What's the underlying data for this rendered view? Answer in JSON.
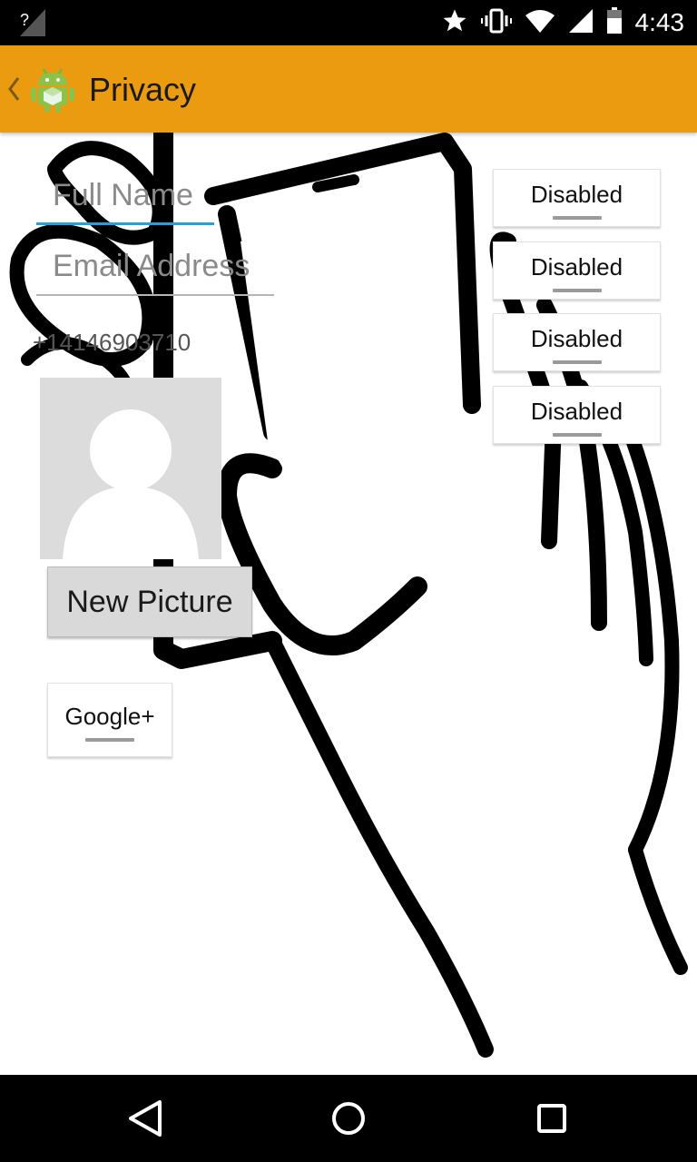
{
  "status_bar": {
    "time": "4:43",
    "signal_text": "?",
    "icons": [
      "signal-unknown-icon",
      "star-icon",
      "vibrate-icon",
      "wifi-icon",
      "cell-signal-icon",
      "battery-icon"
    ]
  },
  "action_bar": {
    "title": "Privacy",
    "background": "#eb9b10"
  },
  "form": {
    "full_name_placeholder": "Full Name",
    "email_placeholder": "Email Address",
    "phone": "+14146903710",
    "new_picture_label": "New Picture",
    "google_plus_label": "Google+"
  },
  "toggles": [
    {
      "label": "Disabled"
    },
    {
      "label": "Disabled"
    },
    {
      "label": "Disabled"
    },
    {
      "label": "Disabled"
    }
  ],
  "nav_bar": {
    "icons": [
      "back-icon",
      "home-icon",
      "recents-icon"
    ]
  }
}
